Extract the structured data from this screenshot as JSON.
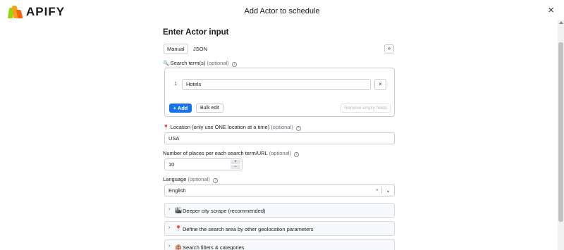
{
  "brand": {
    "name": "APIFY"
  },
  "dialog": {
    "title": "Add Actor to schedule",
    "close_icon": "×"
  },
  "form": {
    "heading": "Enter Actor input",
    "modes": [
      "Manual",
      "JSON"
    ],
    "expand_icon": "»",
    "search_terms": {
      "label": "Search term(s)",
      "optional": "(optional)",
      "rows": [
        {
          "index": "1",
          "value": "Hotels"
        }
      ],
      "remove_row_icon": "×",
      "add_label": "+ Add",
      "bulk_edit_label": "Bulk edit",
      "remove_empty_label": "Remove empty fields"
    },
    "location": {
      "label": "Location (only use ONE location at a time)",
      "optional": "(optional)",
      "value": "USA"
    },
    "max_places": {
      "label": "Number of places per each search term/URL",
      "optional": "(optional)",
      "value": "10",
      "increment_icon": "+",
      "decrement_icon": "−"
    },
    "language": {
      "label": "Language",
      "optional": "(optional)",
      "value": "English",
      "clear_icon": "×",
      "dropdown_icon": "⌄"
    },
    "sections": [
      {
        "title": "Deeper city scrape (recommended)",
        "icon": "🏙"
      },
      {
        "title": "Define the search area by other geolocation parameters",
        "icon": "📍"
      },
      {
        "title": "Search filters & categories",
        "icon": "🏨"
      }
    ],
    "help_icon": "?"
  },
  "colors": {
    "primary": "#1672eb",
    "border": "#c9ccd3",
    "text": "#1a1b21"
  }
}
